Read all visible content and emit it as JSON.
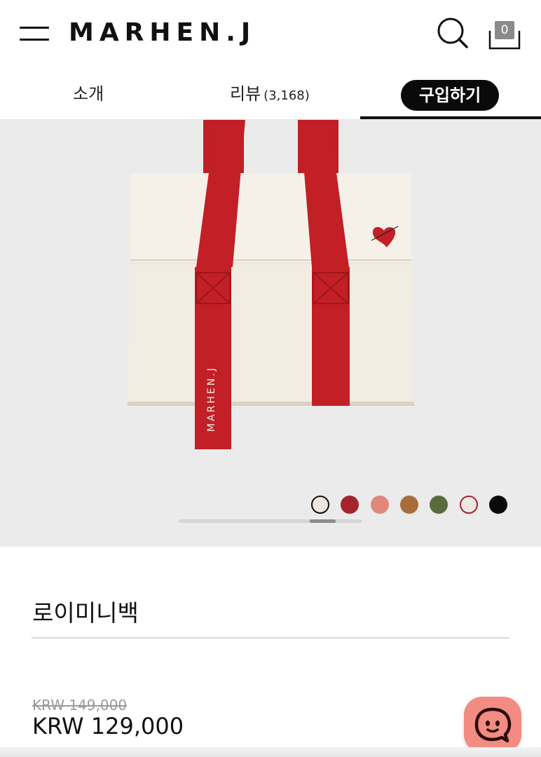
{
  "header": {
    "logo": "MARHEN.J",
    "cart_count": "0"
  },
  "tabs": {
    "intro": "소개",
    "review": "리뷰",
    "review_count": "(3,168)",
    "buy": "구입하기"
  },
  "gallery": {
    "strap_text": "MARHEN.J",
    "swatches": [
      {
        "color": "#ece6dc",
        "selected": true
      },
      {
        "color": "#a3252b",
        "selected": false
      },
      {
        "color": "#e0887a",
        "selected": false
      },
      {
        "color": "#a86d3c",
        "selected": false
      },
      {
        "color": "#5a6b3e",
        "selected": false
      },
      {
        "color": "#efe8e2",
        "selected": false
      },
      {
        "color": "#0a0a0a",
        "selected": false
      }
    ]
  },
  "product": {
    "name": "로이미니백",
    "original_price": "KRW 149,000",
    "price": "KRW 129,000"
  }
}
